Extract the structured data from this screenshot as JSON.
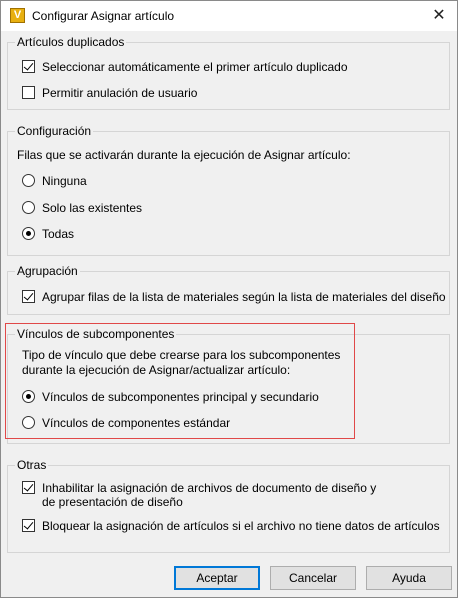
{
  "window": {
    "title": "Configurar Asignar artículo",
    "app_icon_letter": "V",
    "close_glyph": "✕"
  },
  "duplicados": {
    "label": "Artículos duplicados",
    "items": [
      {
        "label": "Seleccionar automáticamente el primer artículo duplicado",
        "checked": true
      },
      {
        "label": "Permitir anulación de usuario",
        "checked": false
      }
    ]
  },
  "configuracion": {
    "label": "Configuración",
    "description": "Filas que se activarán durante la ejecución de Asignar artículo:",
    "options": [
      {
        "label": "Ninguna",
        "selected": false
      },
      {
        "label": "Solo las existentes",
        "selected": false
      },
      {
        "label": "Todas",
        "selected": true
      }
    ]
  },
  "agrupacion": {
    "label": "Agrupación",
    "items": [
      {
        "label": "Agrupar filas de la lista de materiales según la lista de materiales del diseño",
        "checked": true
      }
    ]
  },
  "vinculos": {
    "label": "Vínculos de subcomponentes",
    "description_line1": "Tipo de vínculo que debe crearse para los subcomponentes",
    "description_line2": "durante la ejecución de Asignar/actualizar artículo:",
    "options": [
      {
        "label": "Vínculos de subcomponentes principal y secundario",
        "selected": true
      },
      {
        "label": "Vínculos de componentes estándar",
        "selected": false
      }
    ]
  },
  "otras": {
    "label": "Otras",
    "items": [
      {
        "label_line1": "Inhabilitar la asignación de archivos de documento de diseño y",
        "label_line2": "de presentación de diseño",
        "checked": true
      },
      {
        "label_line1": "Bloquear la asignación de artículos si el archivo no tiene datos de artículos",
        "label_line2": "",
        "checked": true
      }
    ]
  },
  "buttons": {
    "accept": "Aceptar",
    "cancel": "Cancelar",
    "help": "Ayuda"
  },
  "colors": {
    "highlight_border": "#e04848",
    "default_button_border": "#0078d7"
  }
}
